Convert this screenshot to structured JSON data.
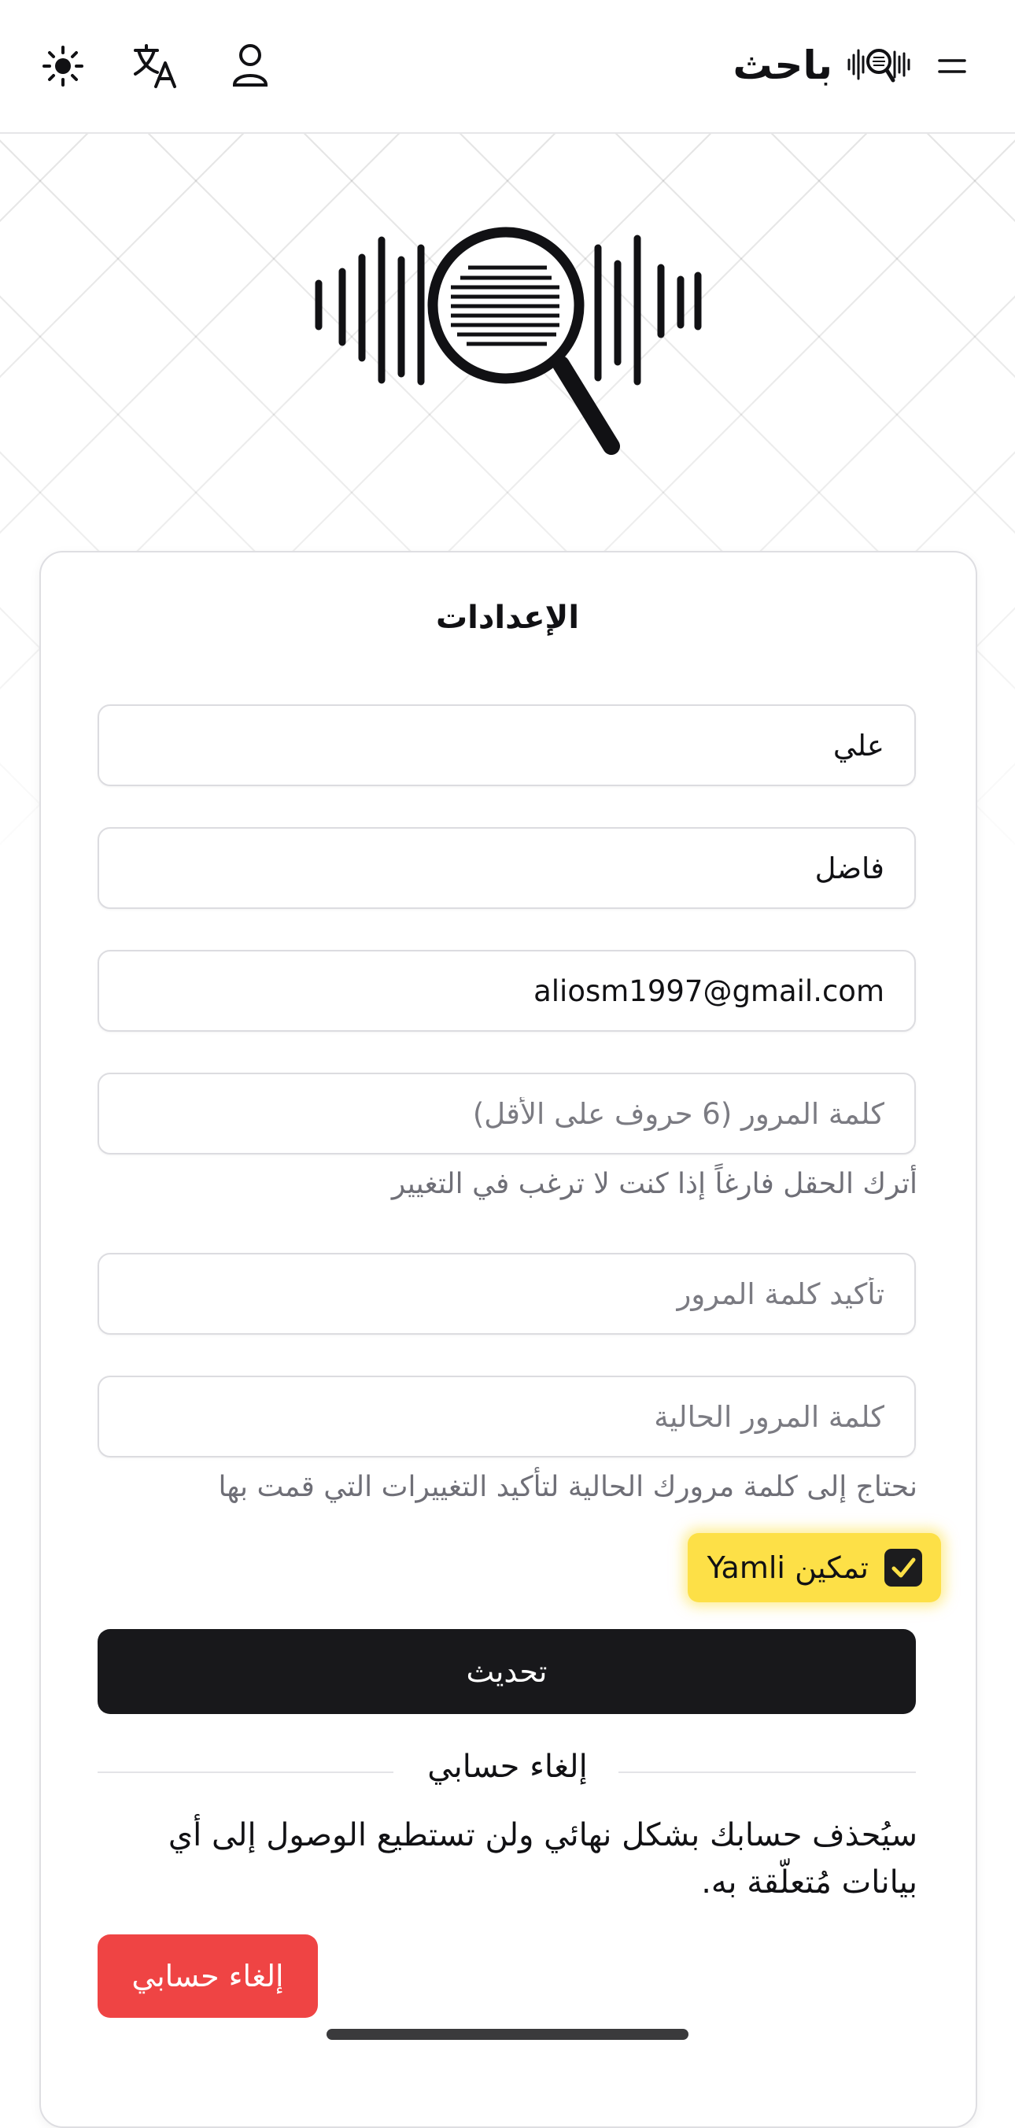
{
  "header": {
    "brand_name": "باحث",
    "icons": [
      "menu-icon",
      "brand-logo-icon",
      "user-icon",
      "translate-icon",
      "sun-icon"
    ]
  },
  "settings": {
    "title": "الإعدادات",
    "first_name": {
      "value": "علي"
    },
    "last_name": {
      "value": "فاضل"
    },
    "email": {
      "value": "aliosm1997@gmail.com"
    },
    "new_password": {
      "value": "",
      "placeholder": "كلمة المرور (6 حروف على الأقل)",
      "hint": "أترك الحقل فارغاً إذا كنت لا ترغب في التغيير"
    },
    "confirm_password": {
      "value": "",
      "placeholder": "تأكيد كلمة المرور"
    },
    "current_password": {
      "value": "",
      "placeholder": "كلمة المرور الحالية",
      "hint": "نحتاج إلى كلمة مرورك الحالية لتأكيد التغييرات التي قمت بها"
    },
    "yamli": {
      "label": "تمكين Yamli",
      "checked": true
    },
    "update_button": "تحديث"
  },
  "delete_account": {
    "section_title": "إلغاء حسابي",
    "warning_line1": "سيُحذف حسابك بشكل نهائي ولن تستطيع الوصول إلى أي",
    "warning_line2": "بيانات مُتعلّقة به.",
    "button": "إلغاء حسابي"
  },
  "colors": {
    "primary": "#18181b",
    "danger": "#ef4444",
    "highlight": "#fde047",
    "border": "#dcdce0",
    "muted_text": "#6f6f77"
  }
}
